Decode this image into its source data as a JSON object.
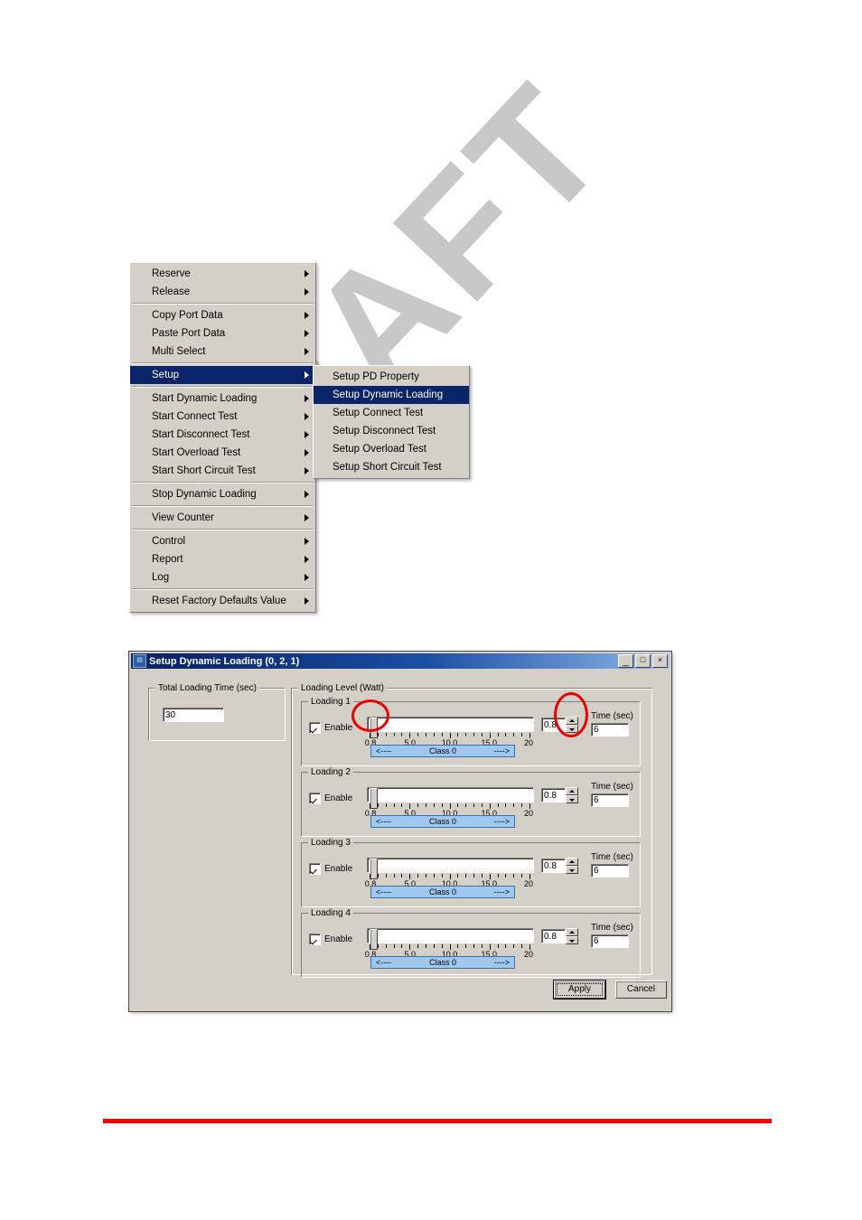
{
  "watermark": {
    "text": "DRAFT"
  },
  "context_menu": {
    "items": [
      {
        "label": "Reserve",
        "has_submenu": true,
        "selected": false
      },
      {
        "label": "Release",
        "has_submenu": true,
        "selected": false
      },
      {
        "separator": true
      },
      {
        "label": "Copy Port Data",
        "has_submenu": true,
        "selected": false
      },
      {
        "label": "Paste Port Data",
        "has_submenu": true,
        "selected": false
      },
      {
        "label": "Multi Select",
        "has_submenu": true,
        "selected": false
      },
      {
        "separator": true
      },
      {
        "label": "Setup",
        "has_submenu": true,
        "selected": true
      },
      {
        "separator": true
      },
      {
        "label": "Start Dynamic Loading",
        "has_submenu": true,
        "selected": false
      },
      {
        "label": "Start Connect Test",
        "has_submenu": true,
        "selected": false
      },
      {
        "label": "Start Disconnect Test",
        "has_submenu": true,
        "selected": false
      },
      {
        "label": "Start Overload Test",
        "has_submenu": true,
        "selected": false
      },
      {
        "label": "Start Short Circuit Test",
        "has_submenu": true,
        "selected": false
      },
      {
        "separator": true
      },
      {
        "label": "Stop Dynamic Loading",
        "has_submenu": true,
        "selected": false
      },
      {
        "separator": true
      },
      {
        "label": "View Counter",
        "has_submenu": true,
        "selected": false
      },
      {
        "separator": true
      },
      {
        "label": "Control",
        "has_submenu": true,
        "selected": false
      },
      {
        "label": "Report",
        "has_submenu": true,
        "selected": false
      },
      {
        "label": "Log",
        "has_submenu": true,
        "selected": false
      },
      {
        "separator": true
      },
      {
        "label": "Reset Factory Defaults Value",
        "has_submenu": true,
        "selected": false
      }
    ]
  },
  "submenu": {
    "items": [
      {
        "label": "Setup PD Property",
        "selected": false
      },
      {
        "label": "Setup Dynamic Loading",
        "selected": true
      },
      {
        "label": "Setup Connect Test",
        "selected": false
      },
      {
        "label": "Setup Disconnect Test",
        "selected": false
      },
      {
        "label": "Setup Overload Test",
        "selected": false
      },
      {
        "label": "Setup Short Circuit Test",
        "selected": false
      }
    ]
  },
  "dialog": {
    "title": "Setup Dynamic Loading (0, 2, 1)",
    "title_icon": "app-icon",
    "window_buttons": {
      "minimize": "_",
      "maximize": "□",
      "close": "×"
    },
    "total_loading_time": {
      "group_label": "Total Loading Time (sec)",
      "value": "30"
    },
    "loading_level": {
      "group_label": "Loading Level (Watt)",
      "groups": [
        {
          "label": "Loading 1",
          "enable_label": "Enable",
          "enabled": true,
          "slider_value": "0.8",
          "slider_min": 0.8,
          "slider_max": 20,
          "tick_labels": [
            "0.8",
            "5.0",
            "10.0",
            "15.0",
            "20"
          ],
          "class_label": "Class 0",
          "class_left_arrow": "<----",
          "class_right_arrow": "---->",
          "time_label": "Time (sec)",
          "time_value": "6"
        },
        {
          "label": "Loading 2",
          "enable_label": "Enable",
          "enabled": true,
          "slider_value": "0.8",
          "slider_min": 0.8,
          "slider_max": 20,
          "tick_labels": [
            "0.8",
            "5.0",
            "10.0",
            "15.0",
            "20"
          ],
          "class_label": "Class 0",
          "class_left_arrow": "<----",
          "class_right_arrow": "---->",
          "time_label": "Time (sec)",
          "time_value": "6"
        },
        {
          "label": "Loading 3",
          "enable_label": "Enable",
          "enabled": true,
          "slider_value": "0.8",
          "slider_min": 0.8,
          "slider_max": 20,
          "tick_labels": [
            "0.8",
            "5.0",
            "10.0",
            "15.0",
            "20"
          ],
          "class_label": "Class 0",
          "class_left_arrow": "<----",
          "class_right_arrow": "---->",
          "time_label": "Time (sec)",
          "time_value": "6"
        },
        {
          "label": "Loading 4",
          "enable_label": "Enable",
          "enabled": true,
          "slider_value": "0.8",
          "slider_min": 0.8,
          "slider_max": 20,
          "tick_labels": [
            "0.8",
            "5.0",
            "10.0",
            "15.0",
            "20"
          ],
          "class_label": "Class 0",
          "class_left_arrow": "<----",
          "class_right_arrow": "---->",
          "time_label": "Time (sec)",
          "time_value": "6"
        }
      ]
    },
    "buttons": {
      "apply": "Apply",
      "cancel": "Cancel"
    }
  },
  "annotations": {
    "highlight_color": "#ee0000",
    "circles": [
      {
        "target": "loading1-slider-thumb"
      },
      {
        "target": "loading1-spinner"
      }
    ]
  },
  "footer": {
    "rule_color": "#ff0000"
  }
}
